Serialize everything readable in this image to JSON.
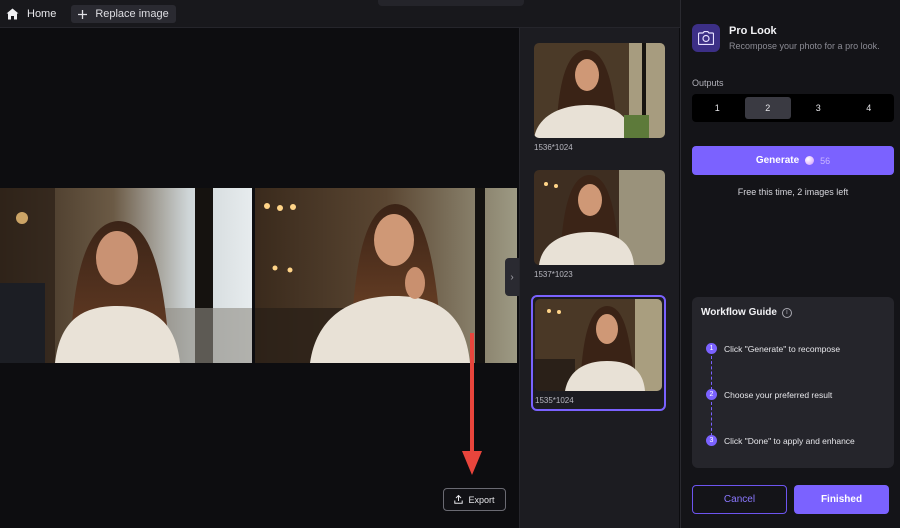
{
  "topbar": {
    "home_label": "Home",
    "replace_label": "Replace image"
  },
  "canvas": {
    "export_label": "Export"
  },
  "thumbnails": [
    {
      "dimensions": "1536*1024"
    },
    {
      "dimensions": "1537*1023"
    },
    {
      "dimensions": "1535*1024",
      "selected": true
    }
  ],
  "panel": {
    "feature_title": "Pro Look",
    "feature_subtitle": "Recompose your photo for a pro look.",
    "outputs_label": "Outputs",
    "outputs_options": [
      "1",
      "2",
      "3",
      "4"
    ],
    "outputs_selected": "2",
    "generate_label": "Generate",
    "generate_cost": "56",
    "free_note": "Free this time, 2 images left",
    "guide_title": "Workflow Guide",
    "steps": [
      {
        "num": "1",
        "text": "Click \"Generate\" to recompose"
      },
      {
        "num": "2",
        "text": "Choose your preferred result"
      },
      {
        "num": "3",
        "text": "Click \"Done\" to apply and enhance"
      }
    ],
    "cancel_label": "Cancel",
    "finished_label": "Finished"
  },
  "colors": {
    "accent": "#7b62ff",
    "annotation_arrow": "#e8453c"
  },
  "icons": {
    "home": "home-icon",
    "replace": "plus-icon",
    "export": "upload-icon",
    "feature": "camera-icon",
    "info": "info-icon",
    "collapse": "chevron-right-icon"
  }
}
